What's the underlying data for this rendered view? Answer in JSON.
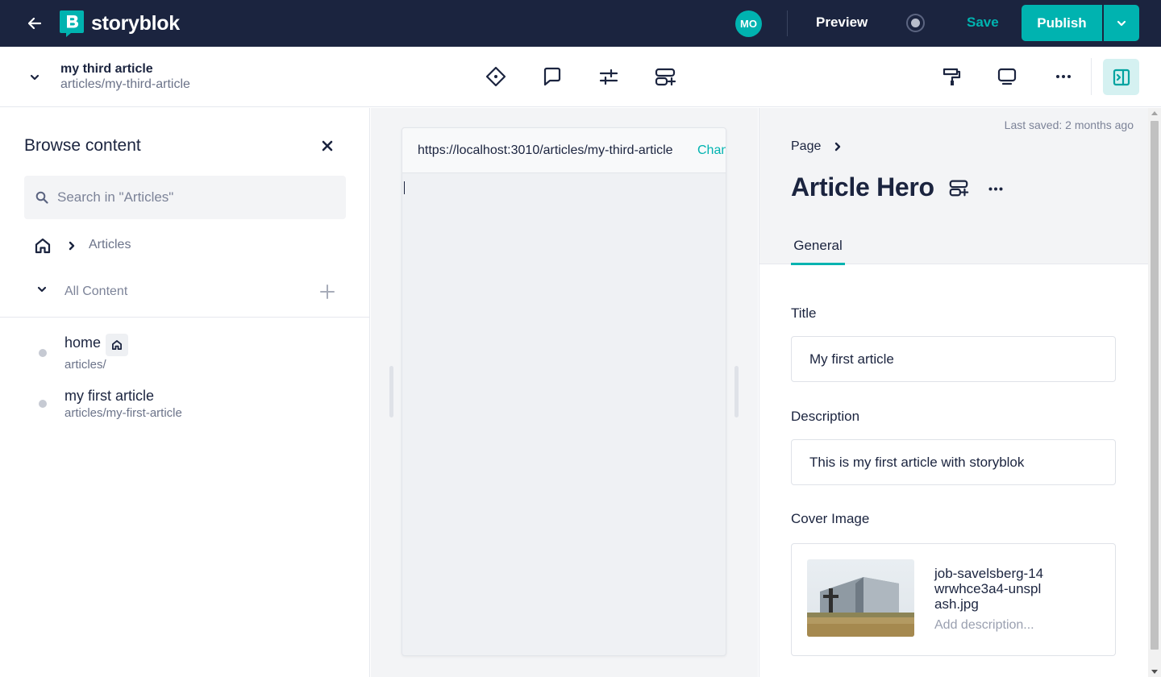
{
  "app": {
    "logo_text": "storyblok",
    "avatar_initials": "MO",
    "preview_label": "Preview",
    "save_label": "Save",
    "publish_label": "Publish",
    "brand_color": "#00b3b0",
    "topbar_color": "#1b243f"
  },
  "story": {
    "name": "my third article",
    "slug": "articles/my-third-article"
  },
  "toolbar": {
    "icons": [
      "diamond-icon",
      "comment-icon",
      "adjustments-icon",
      "insert-block-icon",
      "paint-roller-icon",
      "monitor-icon",
      "more-icon",
      "panel-toggle-icon"
    ]
  },
  "browse": {
    "title": "Browse content",
    "search_placeholder": "Search in \"Articles\"",
    "breadcrumb_folder": "Articles",
    "all_content_label": "All Content",
    "items": [
      {
        "name": "home",
        "slug": "articles/"
      },
      {
        "name": "my first article",
        "slug": "articles/my-first-article"
      }
    ]
  },
  "preview_frame": {
    "url": "https://localhost:3010/articles/my-third-article",
    "change_label": "Change"
  },
  "editor": {
    "last_saved": "Last saved: 2 months ago",
    "breadcrumb": "Page",
    "block_title": "Article Hero",
    "tab_general": "General",
    "fields": {
      "title_label": "Title",
      "title_value": "My first article",
      "description_label": "Description",
      "description_value": "This is my first article with storyblok",
      "cover_label": "Cover Image",
      "cover_filename": "job-savelsberg-14wrwhce3a4-unsplash.jpg",
      "cover_desc_placeholder": "Add description..."
    }
  }
}
